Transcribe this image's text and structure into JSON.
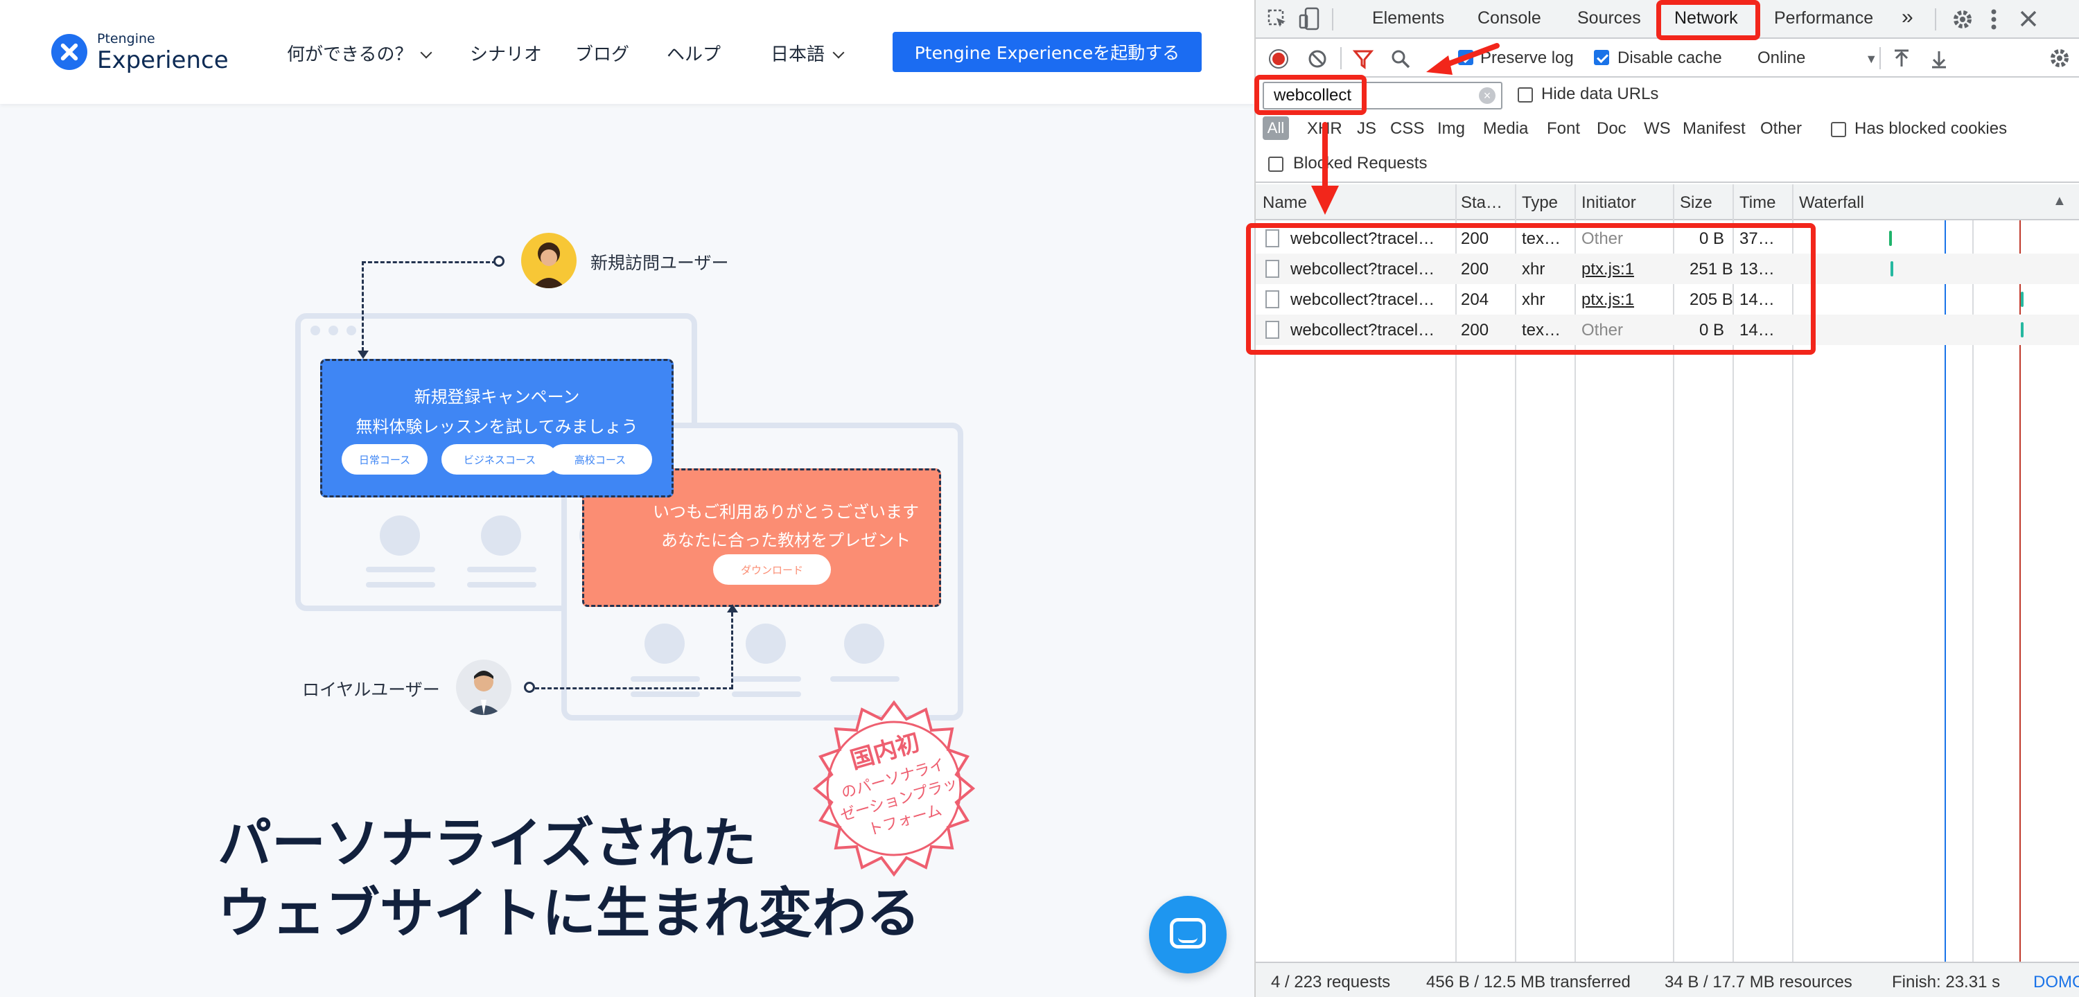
{
  "site": {
    "logo_small": "Ptengine",
    "logo_big": "Experience",
    "nav": [
      "何ができるの？",
      "シナリオ",
      "ブログ",
      "ヘルプ",
      "日本語"
    ],
    "cta": "Ptengine Experienceを起動する",
    "blue_card": {
      "line1": "新規登録キャンペーン",
      "line2": "無料体験レッスンを試してみましょう",
      "pills": [
        "日常コース",
        "ビジネスコース",
        "高校コース"
      ]
    },
    "orange_card": {
      "line1": "いつもご利用ありがとうございます",
      "line2": "あなたに合った教材をプレゼント",
      "button": "ダウンロード"
    },
    "new_visitor": "新規訪問ユーザー",
    "loyal_user": "ロイヤルユーザー",
    "seal": {
      "line1": "国内初",
      "line2": "のパーソナライ",
      "line3": "ゼーションプラッ",
      "line4": "トフォーム"
    },
    "headline1": "パーソナライズされた",
    "headline2": "ウェブサイトに生まれ変わる"
  },
  "devtools": {
    "tabs": [
      "Elements",
      "Console",
      "Sources",
      "Network",
      "Performance"
    ],
    "more_tabs": "»",
    "active_tab": "Network",
    "toolbar": {
      "preserve_log": "Preserve log",
      "disable_cache": "Disable cache",
      "throttle": "Online"
    },
    "filter": {
      "value": "webcollect",
      "hide_data_urls": "Hide data URLs",
      "types": [
        "All",
        "XHR",
        "JS",
        "CSS",
        "Img",
        "Media",
        "Font",
        "Doc",
        "WS",
        "Manifest",
        "Other"
      ],
      "has_blocked_cookies": "Has blocked cookies",
      "blocked_requests": "Blocked Requests"
    },
    "columns": [
      "Name",
      "Sta…",
      "Type",
      "Initiator",
      "Size",
      "Time",
      "Waterfall"
    ],
    "rows": [
      {
        "name": "webcollect?tracel…",
        "status": "200",
        "type": "tex…",
        "initiator": "Other",
        "size": "0 B",
        "time": "37…"
      },
      {
        "name": "webcollect?tracel…",
        "status": "200",
        "type": "xhr",
        "initiator": "ptx.js:1",
        "size": "251 B",
        "time": "13…"
      },
      {
        "name": "webcollect?tracel…",
        "status": "204",
        "type": "xhr",
        "initiator": "ptx.js:1",
        "size": "205 B",
        "time": "14…"
      },
      {
        "name": "webcollect?tracel…",
        "status": "200",
        "type": "tex…",
        "initiator": "Other",
        "size": "0 B",
        "time": "14…"
      }
    ],
    "status_bar": {
      "requests": "4 / 223 requests",
      "transferred": "456 B / 12.5 MB transferred",
      "resources": "34 B / 17.7 MB resources",
      "finish": "Finish: 23.31 s",
      "dom": "DOMC"
    }
  },
  "colors": {
    "cta_blue": "#1b6cf2",
    "annotation_red": "#f2261b",
    "card_blue": "#3f86f4",
    "card_orange": "#fb8d73"
  }
}
